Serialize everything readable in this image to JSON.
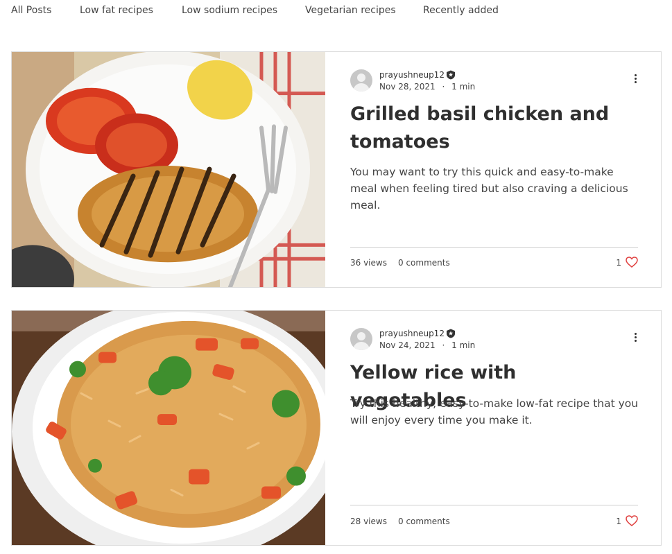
{
  "nav": {
    "items": [
      "All Posts",
      "Low fat recipes",
      "Low sodium recipes",
      "Vegetarian recipes",
      "Recently added"
    ]
  },
  "colors": {
    "like_heart": "#e0403f",
    "border": "#dcdcdc",
    "text": "#333333"
  },
  "icons": {
    "badge": "admin-star-badge-icon",
    "more": "more-vertical-icon",
    "like": "heart-icon",
    "avatar": "default-avatar-icon"
  },
  "posts": [
    {
      "author": "prayushneup12",
      "date": "Nov 28, 2021",
      "separator": "·",
      "read_time": "1 min",
      "title": "Grilled basil chicken and tomatoes",
      "excerpt": "You may want to try this quick and easy-to-make meal when feeling tired but also craving a delicious meal.",
      "views": "36 views",
      "comments": "0 comments",
      "likes": "1"
    },
    {
      "author": "prayushneup12",
      "date": "Nov 24, 2021",
      "separator": "·",
      "read_time": "1 min",
      "title": "Yellow rice with vegetables",
      "excerpt": "Try this healthy, easy-to-make low-fat recipe that you will enjoy every time you make it.",
      "views": "28 views",
      "comments": "0 comments",
      "likes": "1"
    }
  ]
}
